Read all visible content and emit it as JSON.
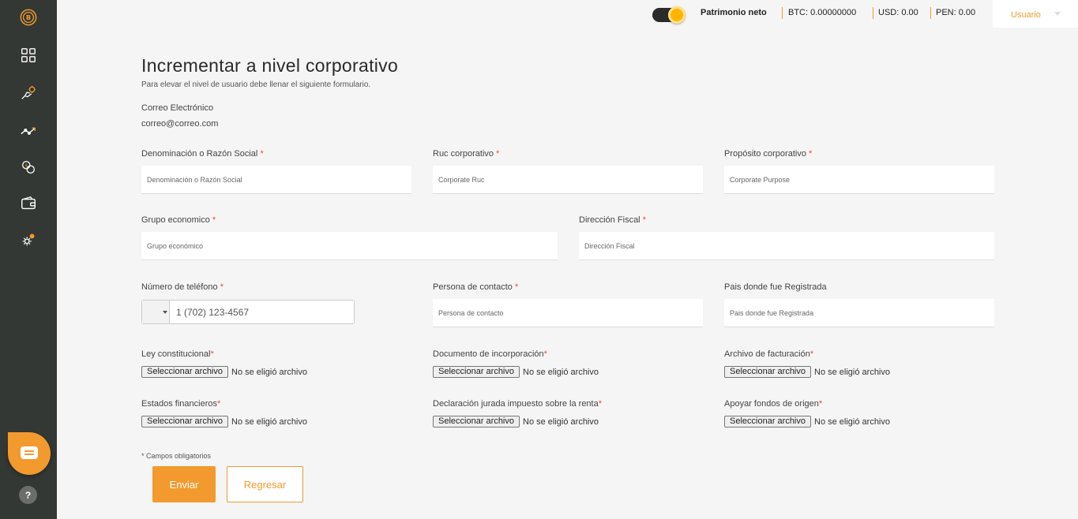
{
  "sidebar": {
    "logo_icon": "bitcoin-coin-icon",
    "items": [
      {
        "icon": "dashboard-grid-icon"
      },
      {
        "icon": "hand-coin-icon"
      },
      {
        "icon": "trend-chart-icon"
      },
      {
        "icon": "exchange-coin-icon"
      },
      {
        "icon": "wallet-icon"
      },
      {
        "icon": "settings-gear-icon"
      }
    ],
    "help_label": "?"
  },
  "header": {
    "patrimonio_label": "Patrimonio neto",
    "btc": "BTC: 0.00000000",
    "usd": "USD: 0.00",
    "pen": "PEN: 0.00",
    "user_label": "Usuario"
  },
  "page": {
    "title": "Incrementar a nivel corporativo",
    "subtitle": "Para elevar el nivel de usuario debe llenar el siguiente formulario.",
    "email_label": "Correo Electrónico",
    "email_value": "correo@correo.com"
  },
  "form": {
    "razon_social": {
      "label": "Denominación o Razón Social",
      "placeholder": "Denominación o Razón Social"
    },
    "ruc": {
      "label": "Ruc corporativo",
      "placeholder": "Corporate Ruc"
    },
    "proposito": {
      "label": "Propósito corporativo",
      "placeholder": "Corporate Purpose"
    },
    "grupo": {
      "label": "Grupo economico",
      "placeholder": "Grupo económico"
    },
    "direccion": {
      "label": "Dirección Fiscal",
      "placeholder": "Dirección Fiscal"
    },
    "telefono": {
      "label": "Número de teléfono",
      "placeholder": "1 (702) 123-4567"
    },
    "contacto": {
      "label": "Persona de contacto",
      "placeholder": "Persona de contacto"
    },
    "pais": {
      "label": "Pais donde fue Registrada",
      "placeholder": "Pais donde fue Registrada"
    },
    "required_mark": "*",
    "files": {
      "ley": {
        "label": "Ley constitucional"
      },
      "documento": {
        "label": "Documento de incorporación"
      },
      "facturacion": {
        "label": "Archivo de facturación"
      },
      "estados": {
        "label": "Estados financieros"
      },
      "declaracion": {
        "label": "Declaración jurada impuesto sobre la renta"
      },
      "fondos": {
        "label": "Apoyar fondos de origen"
      }
    },
    "file_button": "Seleccionar archivo",
    "file_status": "No se eligió archivo",
    "required_note": "* Campos obligatorios",
    "submit": "Enviar",
    "back": "Regresar"
  },
  "colors": {
    "accent": "#f39a2e",
    "sidebar": "#343834",
    "required": "#e74c3c"
  }
}
